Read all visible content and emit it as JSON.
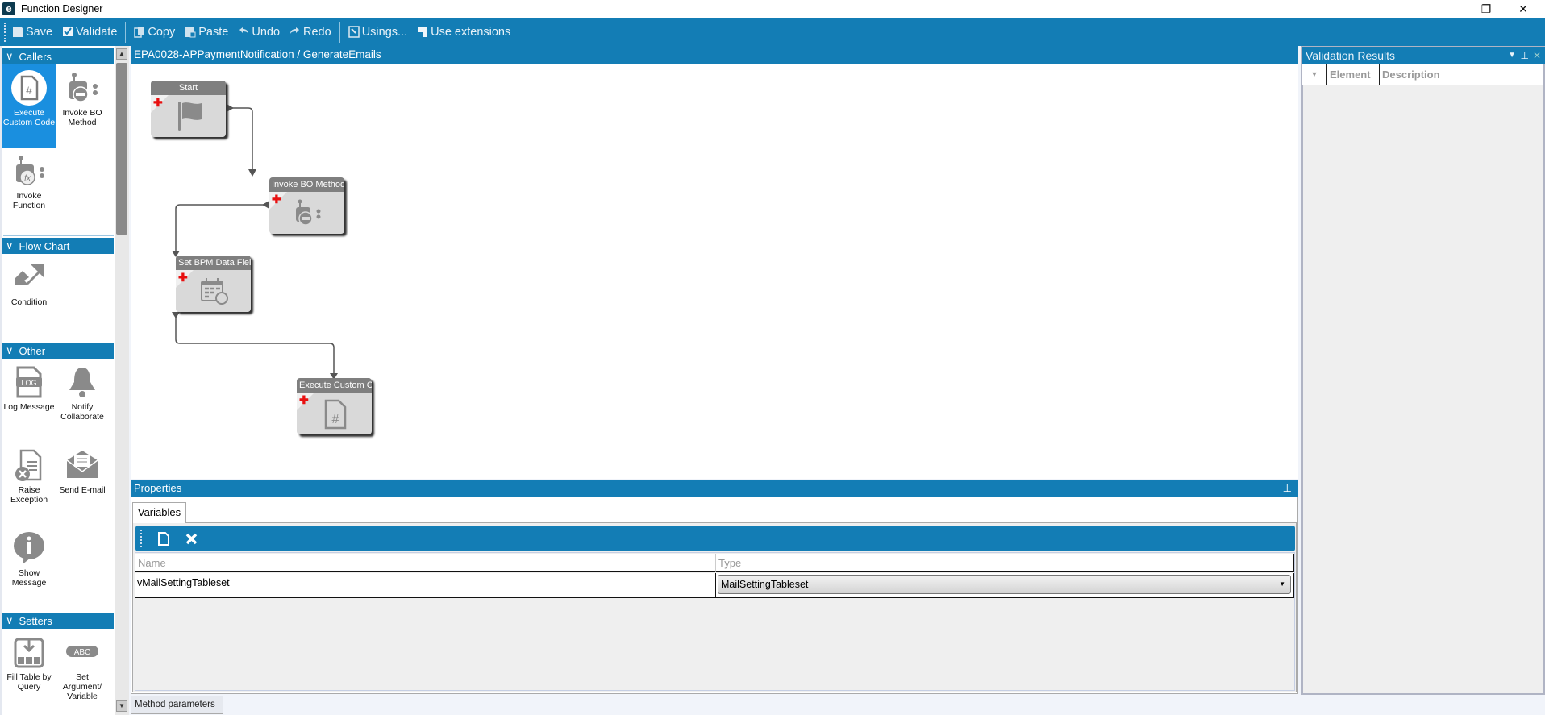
{
  "window": {
    "title": "Function Designer",
    "app_icon": "e",
    "controls": {
      "minimize": "—",
      "restore": "❐",
      "close": "✕"
    }
  },
  "toolbar": {
    "save": "Save",
    "validate": "Validate",
    "copy": "Copy",
    "paste": "Paste",
    "undo": "Undo",
    "redo": "Redo",
    "usings": "Usings...",
    "use_extensions": "Use extensions"
  },
  "palette": {
    "callers": {
      "title": "Callers",
      "items": [
        "Execute Custom Code",
        "Invoke BO Method",
        "Invoke Function"
      ]
    },
    "flow_chart": {
      "title": "Flow Chart",
      "items": [
        "Condition"
      ]
    },
    "other": {
      "title": "Other",
      "items": [
        "Log Message",
        "Notify Collaborate",
        "Raise Exception",
        "Send E-mail",
        "Show Message"
      ]
    },
    "setters": {
      "title": "Setters",
      "items": [
        "Fill Table by Query",
        "Set Argument/ Variable"
      ]
    },
    "log_glyph": "LOG",
    "abc_glyph": "ABC"
  },
  "canvas": {
    "breadcrumb": "EPA0028-APPaymentNotification / GenerateEmails",
    "nodes": [
      "Start",
      "Invoke BO Method",
      "Set BPM Data Field",
      "Execute Custom Code"
    ]
  },
  "properties": {
    "title": "Properties",
    "tab": "Variables",
    "columns": {
      "name": "Name",
      "type": "Type"
    },
    "rows": [
      {
        "name": "vMailSettingTableset",
        "type": "MailSettingTableset"
      }
    ]
  },
  "bottom_tab": "Method parameters",
  "validation": {
    "title": "Validation Results",
    "columns": [
      "Element",
      "Description"
    ]
  },
  "colors": {
    "accent": "#137db5",
    "selected": "#1a8fdf",
    "node_title": "#7f7f7f",
    "node_body": "#d9d9d9"
  }
}
